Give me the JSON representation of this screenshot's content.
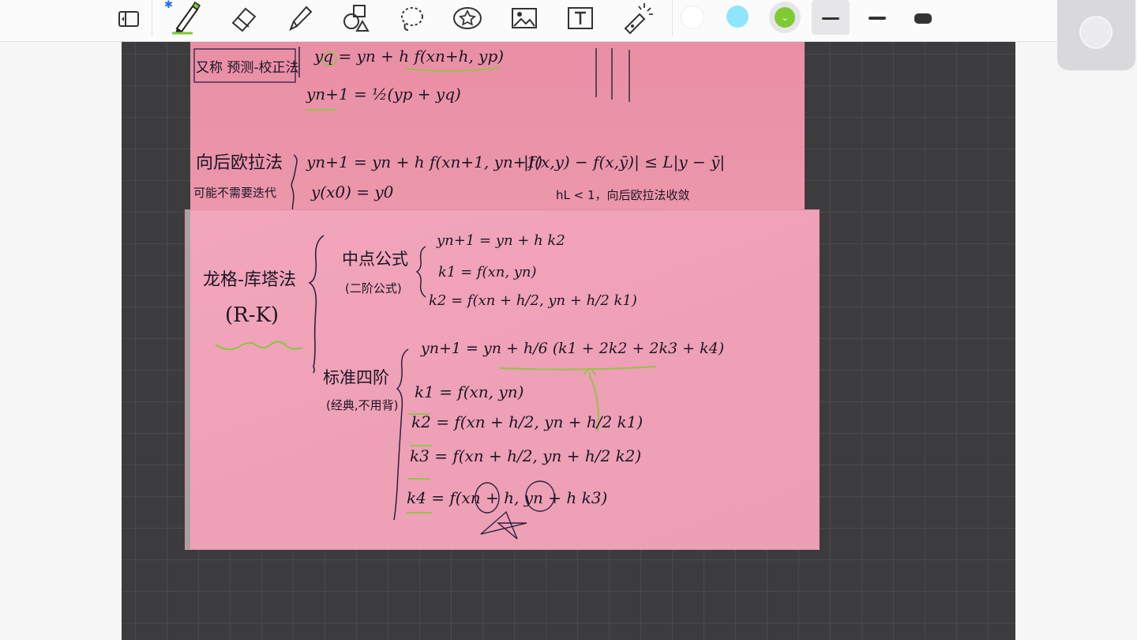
{
  "toolbar": {
    "tools": [
      {
        "name": "sidebar-toggle-icon"
      },
      {
        "name": "pen-icon",
        "selected": true
      },
      {
        "name": "eraser-icon"
      },
      {
        "name": "highlighter-icon"
      },
      {
        "name": "shapes-icon"
      },
      {
        "name": "lasso-icon"
      },
      {
        "name": "sticker-icon"
      },
      {
        "name": "image-icon"
      },
      {
        "name": "text-box-icon",
        "glyph": "T"
      },
      {
        "name": "laser-pointer-icon"
      }
    ],
    "colors": [
      "#ffffff",
      "#8ee6fb",
      "#7ecb33"
    ],
    "selected_color": "#7ecb33",
    "stroke_sizes": [
      "thin",
      "medium",
      "thick"
    ],
    "selected_stroke": "thin"
  },
  "note1": {
    "line1_label": "又称 预测-校正法",
    "line1_formula": "yq = yn + h f(xn+h, yp)",
    "line2_formula": "yn+1 = ½(yp + yq)",
    "method_title": "向后欧拉法",
    "method_note": "可能不需要迭代",
    "eq_a": "yn+1 = yn + h f(xn+1, yn+1)",
    "eq_b": "y(x0) = y0",
    "lipschitz": "|f(x,y) − f(x,ȳ)| ≤ L|y − ȳ|",
    "convergence": "hL < 1，向后欧拉法收敛"
  },
  "note2": {
    "title": "龙格-库塔法",
    "abbr": "(R-K)",
    "midpoint_title": "中点公式",
    "midpoint_sub": "(二阶公式)",
    "mid_eq1": "yn+1 = yn + h k2",
    "mid_eq2": "k1 = f(xn, yn)",
    "mid_eq3": "k2 = f(xn + h/2, yn + h/2 k1)",
    "rk4_title": "标准四阶",
    "rk4_sub": "(经典,不用背)",
    "rk4_eq0": "yn+1 = yn + h/6 (k1 + 2k2 + 2k3 + k4)",
    "rk4_k1": "k1 = f(xn, yn)",
    "rk4_k2": "k2 = f(xn + h/2, yn + h/2 k1)",
    "rk4_k3": "k3 = f(xn + h/2, yn + h/2 k2)",
    "rk4_k4": "k4 = f(xn + h, yn + h k3)"
  }
}
